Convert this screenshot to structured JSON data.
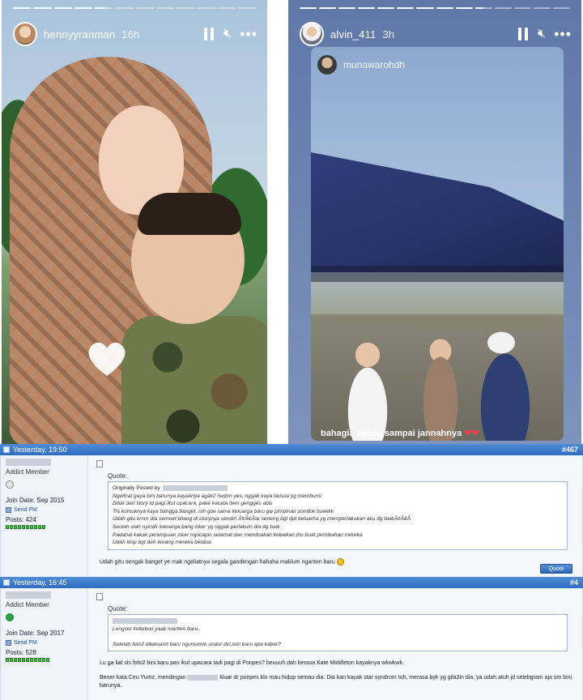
{
  "stories": {
    "left": {
      "username": "hennyyrahman",
      "time": "16h",
      "progress_segments": [
        1,
        1,
        1,
        1,
        0.6,
        0,
        0,
        0,
        0,
        0,
        0,
        0
      ]
    },
    "right": {
      "username": "alvin_411",
      "time": "3h",
      "progress_segments": [
        1,
        1,
        1,
        1,
        1,
        1,
        1,
        1,
        1,
        0.5,
        0,
        0,
        0,
        0
      ],
      "shared_post": {
        "username": "munawarohdh",
        "caption": "bahagia selalu sampai jannahnya",
        "caption_emoji": "❤❤"
      }
    },
    "icons": {
      "pause": "pause-icon",
      "mute": "speaker-mute-icon",
      "more": "more-dots-icon"
    }
  },
  "forum": {
    "posts": [
      {
        "date": "Yesterday, 19:50",
        "number": "#467",
        "rank": "Addict Member",
        "status": "offline",
        "join_date": "Join Date: Sep 2015",
        "send_pm": "Send PM",
        "posts": "Posts: 424",
        "quote_label": "Quote:",
        "quote_by": "Originally Posted by",
        "quote_lines": [
          "Ngelihat gaya bini barunya kayaknya agak2 hedon yes, nggak kaya larissa yg membumi",
          "Diliat dari story td pagi ikut upacara, pake kacata item gengges abis",
          "Trs komuknya kaya bangga banget, nih gue sama keluarga baru gw pimpinan pondok huekkk",
          "Udah gitu kmrn dia semoet bilang di storynya sendiri Ã¢Â€Âœ seneng bgt dpt keluarha yg memperlakukan aku dg baikÃ¢Â€Â",
          "Seolah olah nyindir keluarga bang ziker yg nggak perlakuin dia dg baik",
          "Padahal kakak perempuan ziker ngucapin selamat dan mendoakan kebaikan lho buat pernikahan mereka",
          "Udah klop bgt deh emang mereka berdua"
        ],
        "reply": "Udah gitu sengak banget ye mak ngeliatnya segala gandengan hahaha maklum nganten baru",
        "quote_button": "Quote"
      },
      {
        "date": "Yesterday, 16:45",
        "number": "#4",
        "rank": "Addict Member",
        "status": "online",
        "join_date": "Join Date: Sep 2017",
        "send_pm": "Send PM",
        "posts": "Posts: 528",
        "quote_label": "Quote:",
        "quote_lines": [
          "Lengser kekebon yaak manten baru..",
          "",
          "Setelah foto2 dikeluarin baru ngumumin undur diri.istri baru apa kabar?"
        ],
        "reply_1": "Lu ga liat sis foto2 bini baru pas ikut upacara tadi pagi di Ponpes? beuuuh dah berasa Kate Middleton kayaknya wkwkwk.",
        "reply_2a": "Bener kata Ceu Yumz, mendingan",
        "reply_2b": "kluar dr ponpes klo mau hidup semau dia. Dia kan kayak star syndrom tuh, merasa byk yg gila2in dia, ya udah atuh jd selebgram aja sm bini barunya."
      }
    ]
  }
}
